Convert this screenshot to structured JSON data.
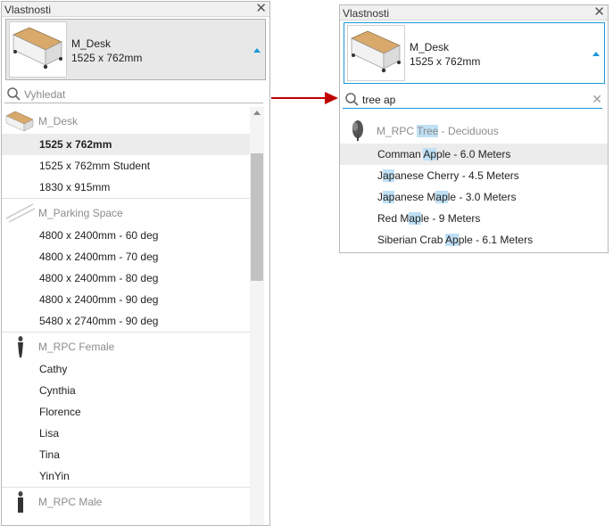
{
  "left_panel": {
    "title": "Vlastnosti",
    "type_selector": {
      "name": "M_Desk",
      "size": "1525 x 762mm"
    },
    "search": {
      "value": "",
      "placeholder": "Vyhledat"
    },
    "groups": [
      {
        "label": "M_Desk",
        "icon": "desk-icon",
        "items": [
          "1525 x 762mm",
          "1525 x 762mm Student",
          "1830 x 915mm"
        ]
      },
      {
        "label": "M_Parking Space",
        "icon": "parking-space-icon",
        "items": [
          "4800 x 2400mm - 60 deg",
          "4800 x 2400mm - 70 deg",
          "4800 x 2400mm - 80 deg",
          "4800 x 2400mm - 90 deg",
          "5480 x 2740mm - 90 deg"
        ]
      },
      {
        "label": "M_RPC Female",
        "icon": "rpc-female-icon",
        "items": [
          "Cathy",
          "Cynthia",
          "Florence",
          "Lisa",
          "Tina",
          "YinYin"
        ]
      },
      {
        "label": "M_RPC Male",
        "icon": "rpc-male-icon",
        "items": []
      }
    ],
    "selected_item": "1525 x 762mm"
  },
  "right_panel": {
    "title": "Vlastnosti",
    "type_selector": {
      "name": "M_Desk",
      "size": "1525 x 762mm"
    },
    "search": {
      "value": "tree ap",
      "placeholder": "Vyhledat"
    },
    "group": {
      "prefix": "M_RPC ",
      "match": "Tree",
      "suffix": " - Deciduous",
      "icon": "tree-icon"
    },
    "items": [
      {
        "parts": [
          [
            "Comman ",
            false
          ],
          [
            "Ap",
            true
          ],
          [
            "ple - 6.0 Meters",
            false
          ]
        ]
      },
      {
        "parts": [
          [
            "J",
            false
          ],
          [
            "ap",
            true
          ],
          [
            "anese Cherry - 4.5 Meters",
            false
          ]
        ]
      },
      {
        "parts": [
          [
            "J",
            false
          ],
          [
            "ap",
            true
          ],
          [
            "anese M",
            false
          ],
          [
            "ap",
            true
          ],
          [
            "le - 3.0 Meters",
            false
          ]
        ]
      },
      {
        "parts": [
          [
            "Red M",
            false
          ],
          [
            "ap",
            true
          ],
          [
            "le - 9 Meters",
            false
          ]
        ]
      },
      {
        "parts": [
          [
            "Siberian Crab ",
            false
          ],
          [
            "Ap",
            true
          ],
          [
            "ple - 6.1 Meters",
            false
          ]
        ]
      }
    ]
  },
  "colors": {
    "accent": "#1c97d6",
    "highlight": "#bfe0f5",
    "arrow": "#c00000"
  }
}
